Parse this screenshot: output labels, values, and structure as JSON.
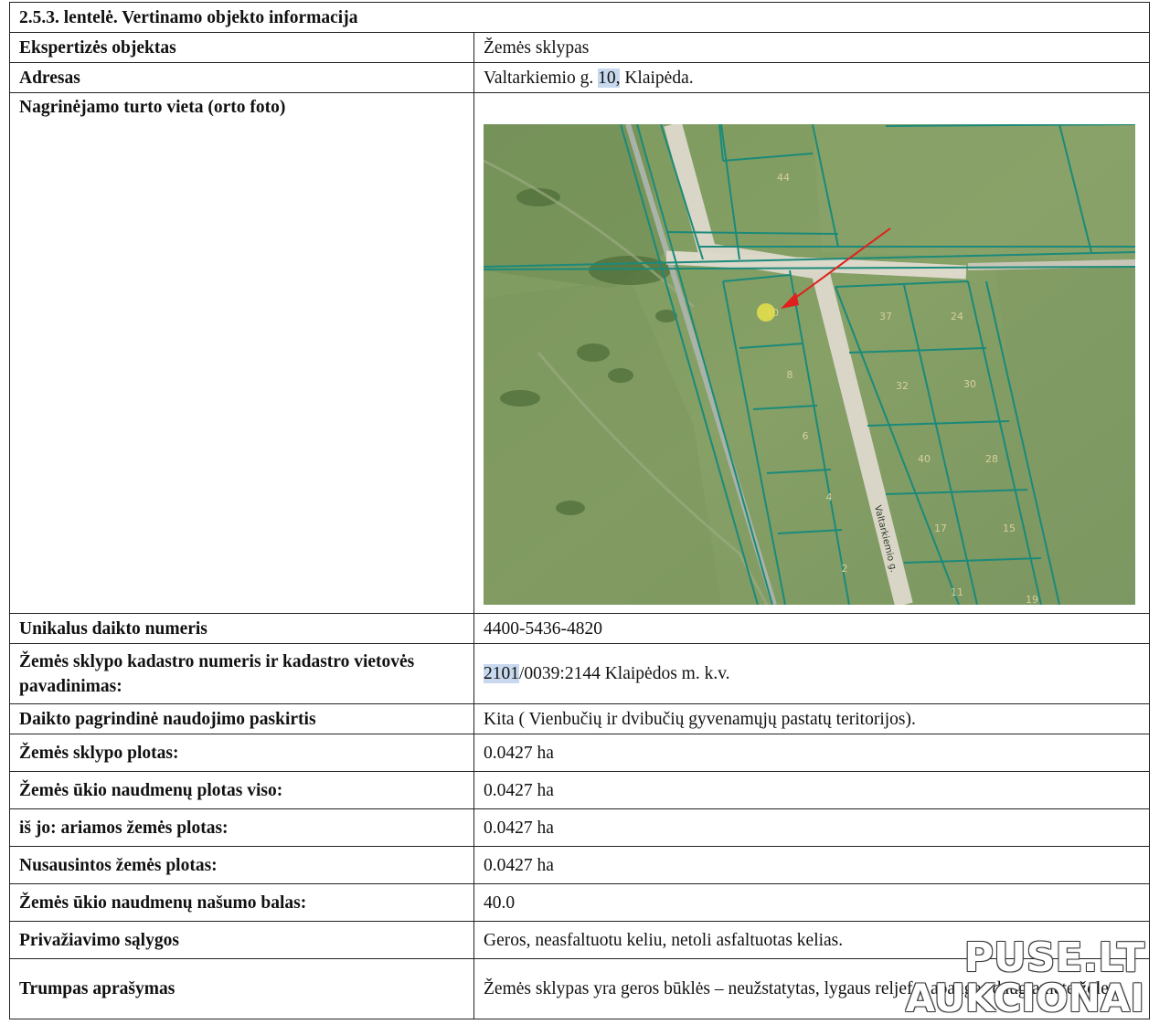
{
  "table_title": "2.5.3. lentelė. Vertinamo objekto informacija",
  "rows": {
    "object": {
      "label": "Ekspertizės objektas",
      "value": "Žemės sklypas"
    },
    "address": {
      "label": "Adresas",
      "value_pre": "Valtarkiemio g. ",
      "value_hl": "10,",
      "value_post": " Klaipėda."
    },
    "photo": {
      "label": "Nagrinėjamo turto vieta (orto foto)"
    },
    "unique_no": {
      "label": "Unikalus daikto numeris",
      "value": "4400-5436-4820"
    },
    "cadastre": {
      "label": "Žemės sklypo kadastro numeris ir kadastro vietovės pavadinimas:",
      "value_hl": "2101",
      "value_post": "/0039:2144 Klaipėdos m. k.v."
    },
    "purpose": {
      "label": "Daikto pagrindinė naudojimo paskirtis",
      "value": "Kita ( Vienbučių ir dvibučių gyvenamųjų pastatų teritorijos)."
    },
    "plot_area": {
      "label": "Žemės sklypo plotas:",
      "value": "0.0427 ha"
    },
    "agri_area": {
      "label": "Žemės ūkio naudmenų plotas viso:",
      "value": "0.0427 ha"
    },
    "arable_area": {
      "label": "iš jo: ariamos žemės plotas:",
      "value": "0.0427 ha"
    },
    "drained_area": {
      "label": "Nusausintos žemės plotas:",
      "value": "0.0427 ha"
    },
    "productivity": {
      "label": "Žemės ūkio naudmenų našumo balas:",
      "value": "40.0"
    },
    "access": {
      "label": "Privažiavimo sąlygos",
      "value": "Geros, neasfaltuotu keliu, netoli asfaltuotas kelias."
    },
    "description": {
      "label": "Trumpas aprašymas",
      "value": "Žemės sklypas yra geros būklės – neužstatytas, lygaus reljefo, apaugęs daugiamete žole."
    }
  },
  "map": {
    "street_label": "Valtarkiemio g.",
    "parcel_numbers": [
      "44",
      "10",
      "8",
      "6",
      "4",
      "2",
      "37",
      "24",
      "32",
      "30",
      "40",
      "28",
      "17",
      "15",
      "11",
      "19"
    ]
  },
  "watermark": {
    "line1": "PUSE.LT",
    "line2": "AUKCIONAI"
  }
}
